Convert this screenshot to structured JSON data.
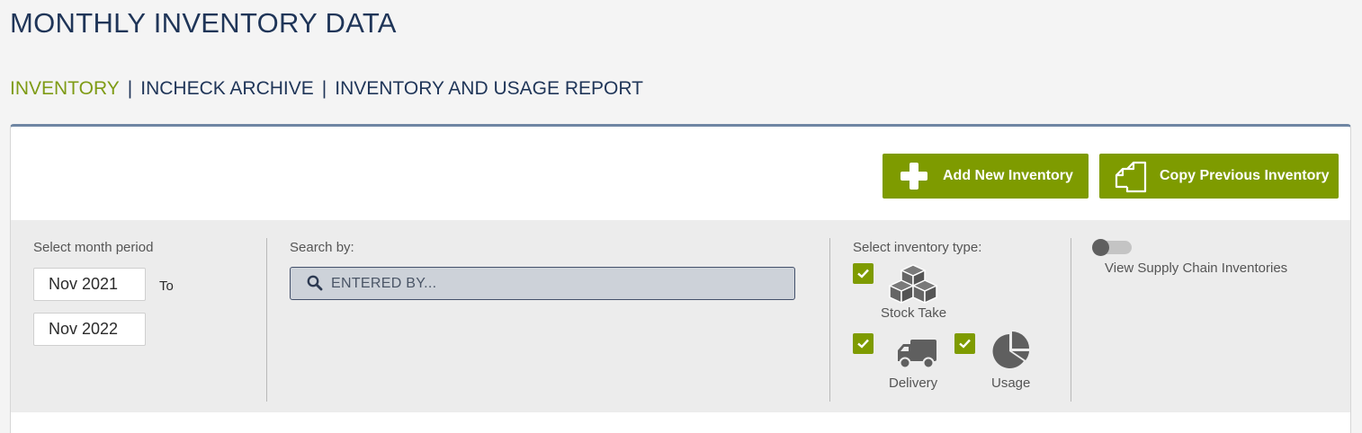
{
  "page": {
    "title": "MONTHLY INVENTORY DATA"
  },
  "nav": {
    "items": [
      {
        "label": "INVENTORY",
        "active": true
      },
      {
        "label": "INCHECK ARCHIVE",
        "active": false
      },
      {
        "label": "INVENTORY AND USAGE REPORT",
        "active": false
      }
    ],
    "separator": "|"
  },
  "actions": {
    "add_label": "Add New Inventory",
    "copy_label": "Copy Previous Inventory"
  },
  "filters": {
    "period": {
      "label": "Select month period",
      "from": "Nov 2021",
      "to_word": "To",
      "to": "Nov 2022"
    },
    "search": {
      "label": "Search by:",
      "placeholder": "ENTERED BY..."
    },
    "types": {
      "label": "Select inventory type:",
      "stock_take": {
        "label": "Stock Take",
        "checked": true,
        "icon": "boxes-icon"
      },
      "delivery": {
        "label": "Delivery",
        "checked": true,
        "icon": "truck-icon"
      },
      "usage": {
        "label": "Usage",
        "checked": true,
        "icon": "pie-chart-icon"
      }
    },
    "supply_chain": {
      "label": "View Supply Chain Inventories",
      "enabled": false
    }
  },
  "colors": {
    "accent": "#7e9b00",
    "navy": "#1f3558",
    "panel_border": "#6f86a3"
  }
}
